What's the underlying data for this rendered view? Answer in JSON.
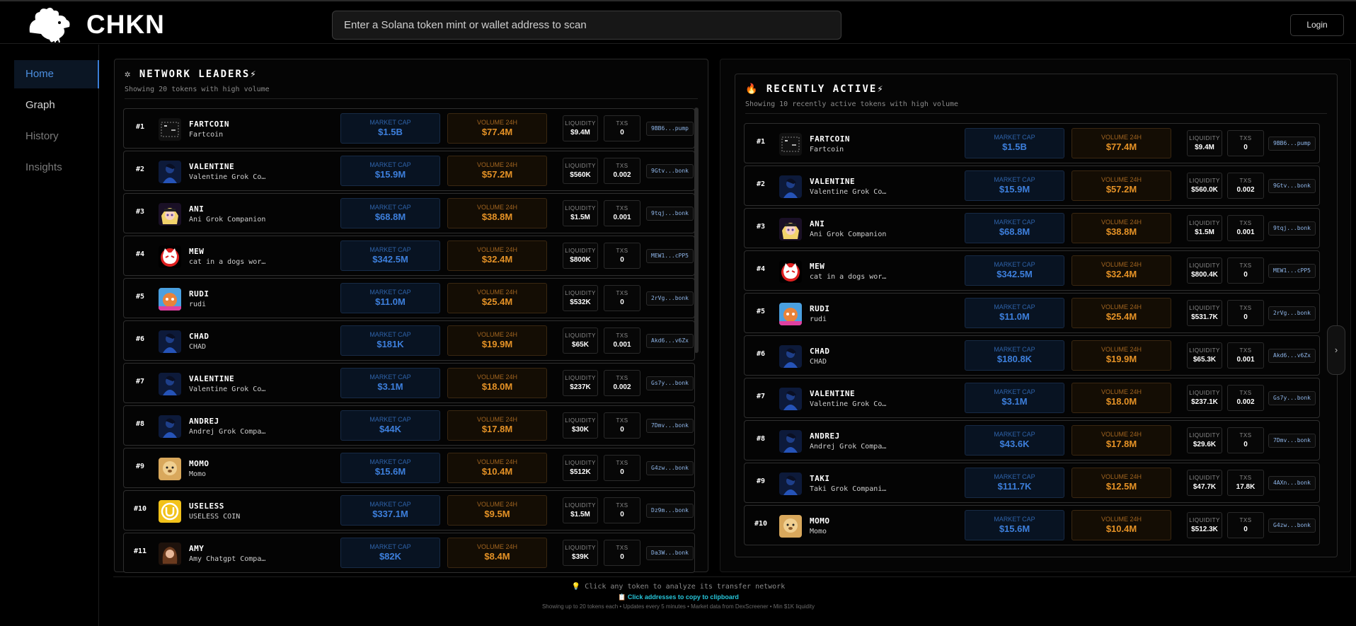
{
  "header": {
    "brand": "CHKN",
    "search_placeholder": "Enter a Solana token mint or wallet address to scan",
    "login_label": "Login"
  },
  "sidebar": {
    "items": [
      {
        "label": "Home",
        "active": true
      },
      {
        "label": "Graph"
      },
      {
        "label": "History"
      },
      {
        "label": "Insights"
      }
    ]
  },
  "labels": {
    "market_cap": "MARKET CAP",
    "volume_24h": "VOLUME 24H",
    "liquidity": "LIQUIDITY",
    "txs": "TXS"
  },
  "leaders": {
    "icon": "✲",
    "title": "NETWORK LEADERS⚡",
    "subtitle": "Showing 20 tokens with high volume",
    "rows": [
      {
        "rank": "#1",
        "symbol": "FARTCOIN",
        "name": "Fartcoin",
        "mcap": "$1.5B",
        "vol": "$77.4M",
        "liq": "$9.4M",
        "txs": "0",
        "addr": "9BB6...pump",
        "icon": "fartcoin-icon"
      },
      {
        "rank": "#2",
        "symbol": "VALENTINE",
        "name": "Valentine Grok Co…",
        "mcap": "$15.9M",
        "vol": "$57.2M",
        "liq": "$560K",
        "txs": "0.002",
        "addr": "9Gtv...bonk",
        "icon": "valentine-icon"
      },
      {
        "rank": "#3",
        "symbol": "ANI",
        "name": "Ani Grok Companion",
        "mcap": "$68.8M",
        "vol": "$38.8M",
        "liq": "$1.5M",
        "txs": "0.001",
        "addr": "9tqj...bonk",
        "icon": "ani-icon"
      },
      {
        "rank": "#4",
        "symbol": "MEW",
        "name": "cat in a dogs wor…",
        "mcap": "$342.5M",
        "vol": "$32.4M",
        "liq": "$800K",
        "txs": "0",
        "addr": "MEW1...cPP5",
        "icon": "mew-icon"
      },
      {
        "rank": "#5",
        "symbol": "RUDI",
        "name": "rudi",
        "mcap": "$11.0M",
        "vol": "$25.4M",
        "liq": "$532K",
        "txs": "0",
        "addr": "2rVg...bonk",
        "icon": "rudi-icon"
      },
      {
        "rank": "#6",
        "symbol": "CHAD",
        "name": "CHAD",
        "mcap": "$181K",
        "vol": "$19.9M",
        "liq": "$65K",
        "txs": "0.001",
        "addr": "Akd6...v6Zx",
        "icon": "chad-icon"
      },
      {
        "rank": "#7",
        "symbol": "VALENTINE",
        "name": "Valentine Grok Co…",
        "mcap": "$3.1M",
        "vol": "$18.0M",
        "liq": "$237K",
        "txs": "0.002",
        "addr": "Gs7y...bonk",
        "icon": "valentine-icon"
      },
      {
        "rank": "#8",
        "symbol": "ANDREJ",
        "name": "Andrej Grok Compa…",
        "mcap": "$44K",
        "vol": "$17.8M",
        "liq": "$30K",
        "txs": "0",
        "addr": "7Dmv...bonk",
        "icon": "andrej-icon"
      },
      {
        "rank": "#9",
        "symbol": "MOMO",
        "name": "Momo",
        "mcap": "$15.6M",
        "vol": "$10.4M",
        "liq": "$512K",
        "txs": "0",
        "addr": "G4zw...bonk",
        "icon": "momo-icon"
      },
      {
        "rank": "#10",
        "symbol": "USELESS",
        "name": "USELESS COIN",
        "mcap": "$337.1M",
        "vol": "$9.5M",
        "liq": "$1.5M",
        "txs": "0",
        "addr": "Dz9m...bonk",
        "icon": "useless-icon"
      },
      {
        "rank": "#11",
        "symbol": "AMY",
        "name": "Amy Chatgpt Compa…",
        "mcap": "$82K",
        "vol": "$8.4M",
        "liq": "$39K",
        "txs": "0",
        "addr": "Da3W...bonk",
        "icon": "amy-icon"
      }
    ]
  },
  "recent": {
    "icon": "🔥",
    "title": "RECENTLY ACTIVE⚡",
    "subtitle": "Showing 10 recently active tokens with high volume",
    "rows": [
      {
        "rank": "#1",
        "symbol": "FARTCOIN",
        "name": "Fartcoin",
        "mcap": "$1.5B",
        "vol": "$77.4M",
        "liq": "$9.4M",
        "txs": "0",
        "addr": "9BB6...pump",
        "icon": "fartcoin-icon"
      },
      {
        "rank": "#2",
        "symbol": "VALENTINE",
        "name": "Valentine Grok Co…",
        "mcap": "$15.9M",
        "vol": "$57.2M",
        "liq": "$560.0K",
        "txs": "0.002",
        "addr": "9Gtv...bonk",
        "icon": "valentine-icon"
      },
      {
        "rank": "#3",
        "symbol": "ANI",
        "name": "Ani Grok Companion",
        "mcap": "$68.8M",
        "vol": "$38.8M",
        "liq": "$1.5M",
        "txs": "0.001",
        "addr": "9tqj...bonk",
        "icon": "ani-icon"
      },
      {
        "rank": "#4",
        "symbol": "MEW",
        "name": "cat in a dogs wor…",
        "mcap": "$342.5M",
        "vol": "$32.4M",
        "liq": "$800.4K",
        "txs": "0",
        "addr": "MEW1...cPP5",
        "icon": "mew-icon"
      },
      {
        "rank": "#5",
        "symbol": "RUDI",
        "name": "rudi",
        "mcap": "$11.0M",
        "vol": "$25.4M",
        "liq": "$531.7K",
        "txs": "0",
        "addr": "2rVg...bonk",
        "icon": "rudi-icon"
      },
      {
        "rank": "#6",
        "symbol": "CHAD",
        "name": "CHAD",
        "mcap": "$180.8K",
        "vol": "$19.9M",
        "liq": "$65.3K",
        "txs": "0.001",
        "addr": "Akd6...v6Zx",
        "icon": "chad-icon"
      },
      {
        "rank": "#7",
        "symbol": "VALENTINE",
        "name": "Valentine Grok Co…",
        "mcap": "$3.1M",
        "vol": "$18.0M",
        "liq": "$237.1K",
        "txs": "0.002",
        "addr": "Gs7y...bonk",
        "icon": "valentine-icon"
      },
      {
        "rank": "#8",
        "symbol": "ANDREJ",
        "name": "Andrej Grok Compa…",
        "mcap": "$43.6K",
        "vol": "$17.8M",
        "liq": "$29.6K",
        "txs": "0",
        "addr": "7Dmv...bonk",
        "icon": "andrej-icon"
      },
      {
        "rank": "#9",
        "symbol": "TAKI",
        "name": "Taki Grok Compani…",
        "mcap": "$111.7K",
        "vol": "$12.5M",
        "liq": "$47.7K",
        "txs": "17.8K",
        "addr": "4AXn...bonk",
        "icon": "taki-icon"
      },
      {
        "rank": "#10",
        "symbol": "MOMO",
        "name": "Momo",
        "mcap": "$15.6M",
        "vol": "$10.4M",
        "liq": "$512.3K",
        "txs": "0",
        "addr": "G4zw...bonk",
        "icon": "momo-icon"
      }
    ]
  },
  "footer": {
    "line1": "💡 Click any token to analyze its transfer network",
    "line2": "📋 Click addresses to copy to clipboard",
    "line3": "Showing up to 20 tokens each • Updates every 5 minutes • Market data from DexScreener • Min $1K liquidity"
  },
  "colors": {
    "accent_blue": "#3d7fdc",
    "accent_orange": "#e59226",
    "footer_cyan": "#26c6da"
  }
}
